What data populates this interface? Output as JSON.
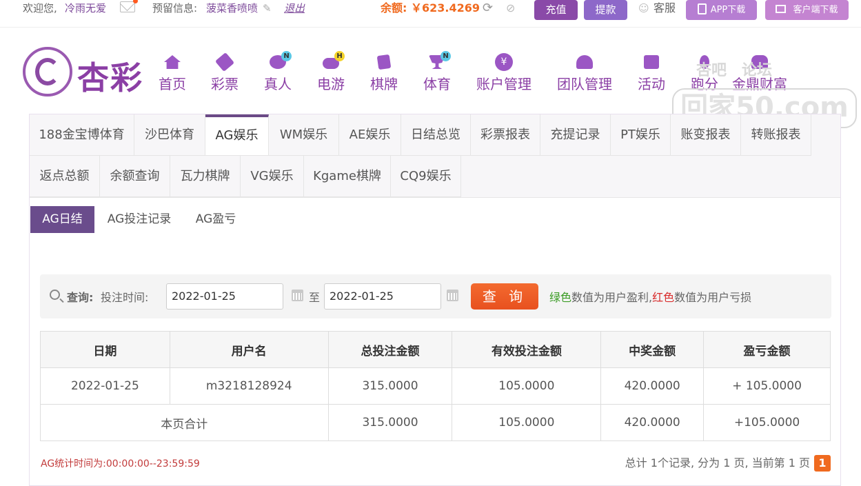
{
  "topbar": {
    "welcome_label": "欢迎您,",
    "username": "冷雨无爱",
    "reserved_label": "预留信息:",
    "reserved_value": "菠菜香喷喷",
    "logout": "退出",
    "balance_label": "余额:",
    "balance_value": "￥623.4269",
    "charge": "充值",
    "withdraw": "提款",
    "service": "客服",
    "app_download": "APP下载",
    "client_download": "客户端下载"
  },
  "header": {
    "logo_text": "杏彩",
    "nav": [
      {
        "label": "首页",
        "icon": "home-icon"
      },
      {
        "label": "彩票",
        "icon": "lottery-icon"
      },
      {
        "label": "真人",
        "icon": "dealer-icon",
        "badge": "N"
      },
      {
        "label": "电游",
        "icon": "gamepad-icon",
        "badge": "H"
      },
      {
        "label": "棋牌",
        "icon": "cards-icon"
      },
      {
        "label": "体育",
        "icon": "trophy-icon",
        "badge": "N"
      },
      {
        "label": "账户管理",
        "icon": "yuan-coin-icon"
      },
      {
        "label": "团队管理",
        "icon": "team-icon"
      },
      {
        "label": "活动",
        "icon": "gift-icon"
      },
      {
        "label": "跑分",
        "icon": "run-icon"
      },
      {
        "label": "金鼎财富",
        "icon": "wealth-icon"
      }
    ],
    "watermark_top": "杏吧　论坛",
    "watermark_main": "回家50.com"
  },
  "tabs": {
    "row1": [
      "188金宝博体育",
      "沙巴体育",
      "AG娱乐",
      "WM娱乐",
      "AE娱乐",
      "日结总览",
      "彩票报表",
      "充提记录",
      "PT娱乐",
      "账变报表",
      "转账报表"
    ],
    "row2": [
      "返点总额",
      "余额查询",
      "瓦力棋牌",
      "VG娱乐",
      "Kgame棋牌",
      "CQ9娱乐"
    ],
    "active": "AG娱乐"
  },
  "subtabs": [
    "AG日结",
    "AG投注记录",
    "AG盈亏"
  ],
  "query": {
    "label": "查询:",
    "time_label": "投注时间:",
    "start_date": "2022-01-25",
    "to": "至",
    "end_date": "2022-01-25",
    "button": "查 询",
    "hint_green": "绿色",
    "hint_mid": "数值为用户盈利,",
    "hint_red": "红色",
    "hint_end": "数值为用户亏损"
  },
  "table": {
    "headers": [
      "日期",
      "用户名",
      "总投注金额",
      "有效投注金额",
      "中奖金额",
      "盈亏金额"
    ],
    "row": [
      "2022-01-25",
      "m3218128924",
      "315.0000",
      "105.0000",
      "420.0000",
      "+ 105.0000"
    ],
    "total": [
      "本页合计",
      "315.0000",
      "105.0000",
      "420.0000",
      "+105.0000"
    ]
  },
  "footer": {
    "note": "AG统计时间为:00:00:00--23:59:59",
    "pager_text": "总计 1个记录, 分为 1 页, 当前第 1 页",
    "current_page": "1"
  },
  "colors": {
    "brand": "#8b3fa5",
    "accent": "#f06a1f",
    "profit": "#3a9b24",
    "loss": "#d82b2b"
  }
}
